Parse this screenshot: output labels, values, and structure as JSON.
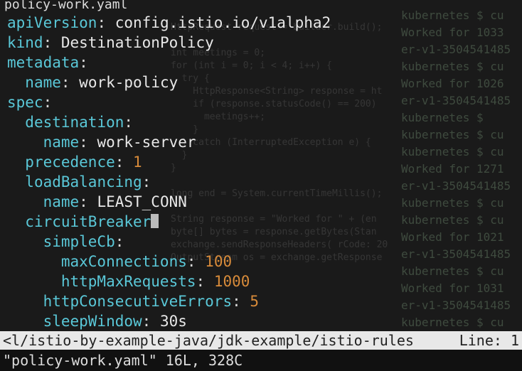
{
  "filename": "policy-work.yaml",
  "yaml": {
    "apiVersion": {
      "key": "apiVersion",
      "value": "config.istio.io/v1alpha2"
    },
    "kind": {
      "key": "kind",
      "value": "DestinationPolicy"
    },
    "metadata": {
      "key": "metadata"
    },
    "metadata_name": {
      "key": "name",
      "value": "work-policy"
    },
    "spec": {
      "key": "spec"
    },
    "destination": {
      "key": "destination"
    },
    "destination_name": {
      "key": "name",
      "value": "work-server"
    },
    "precedence": {
      "key": "precedence",
      "value": "1"
    },
    "loadBalancing": {
      "key": "loadBalancing"
    },
    "lb_name": {
      "key": "name",
      "value": "LEAST_CONN"
    },
    "circuitBreaker": {
      "key": "circuitBreaker"
    },
    "simpleCb": {
      "key": "simpleCb"
    },
    "maxConnections": {
      "key": "maxConnections",
      "value": "100"
    },
    "httpMaxRequests": {
      "key": "httpMaxRequests",
      "value": "1000"
    },
    "httpConsecutiveErrors": {
      "key": "httpConsecutiveErrors",
      "value": "5"
    },
    "sleepWindow": {
      "key": "sleepWindow",
      "value": "30s"
    }
  },
  "status": {
    "path": "<l/istio-by-example-java/jdk-example/istio-rules",
    "line": "Line: 1"
  },
  "cmdline": "\"policy-work.yaml\" 16L, 328C",
  "bg_java": "HttpRequest request = builder.build();\n\nint meetings = 0;\nfor (int i = 0; i < 4; i++) {\n  try {\n    HttpResponse<String> response = ht\n    if (response.statusCode() == 200)\n      meetings++;\n    }\n  } catch (InterruptedException e) {\n  }\n}\n\nlong end = System.currentTimeMillis();\n\nString response = \"Worked for \" + (en\nbyte[] bytes = response.getBytes(Stan\nexchange.sendResponseHeaders( rCode: 20\nOutputStream os = exchange.getResponse",
  "bg_k8s": "kubernetes $ cu\nWorked for 1033\ner-v1-3504541485\nkubernetes $ cu\nWorked for 1026\ner-v1-3504541485\nkubernetes $\nkubernetes $ cu\nkubernetes $ cu\nWorked for 1271\ner-v1-3504541485\nkubernetes $ cu\nkubernetes $ cu\nWorked for 1021\ner-v1-3504541485\nkubernetes $ cu\nWorked for 1031\ner-v1-3504541485\nkubernetes $ cu"
}
